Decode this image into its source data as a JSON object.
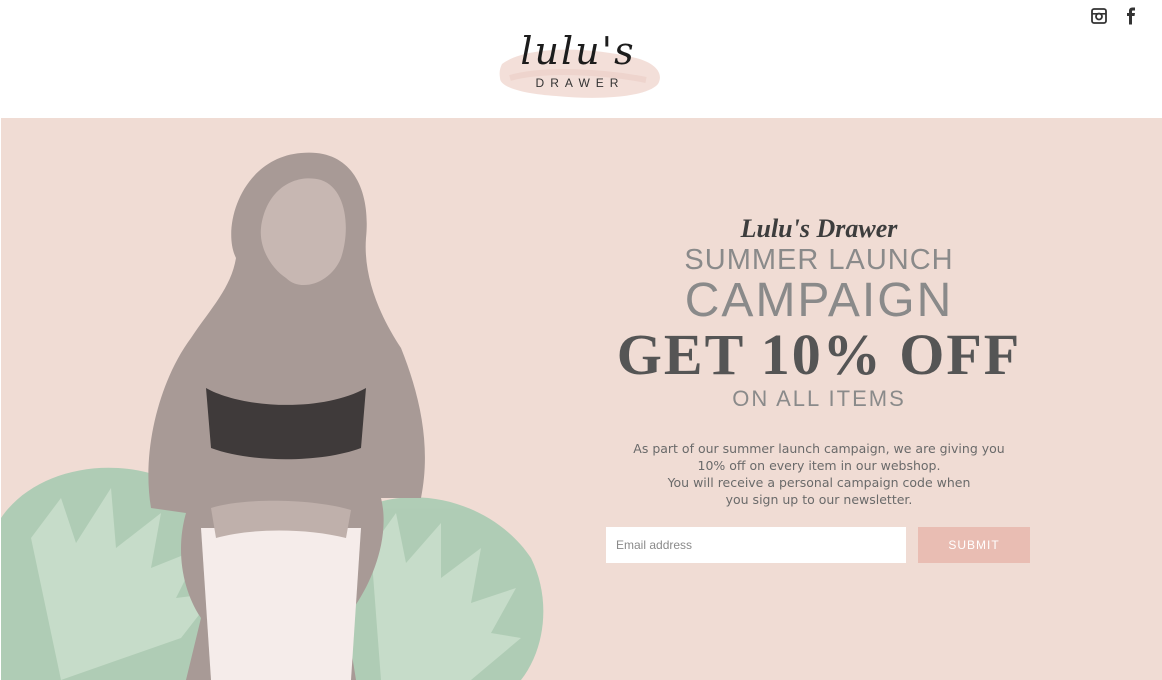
{
  "header": {
    "logo": {
      "script": "lulu's",
      "subtitle": "DRAWER"
    },
    "social": [
      {
        "name": "instagram",
        "icon": "instagram-icon"
      },
      {
        "name": "facebook",
        "icon": "facebook-icon"
      }
    ]
  },
  "hero": {
    "brand_line": "Lulu's Drawer",
    "line_summer": "SUMMER LAUNCH",
    "line_campaign": "CAMPAIGN",
    "line_offer": "GET 10% OFF",
    "line_all": "ON ALL ITEMS",
    "description": [
      "As part of our summer launch campaign, we are giving you",
      "10% off on every item in our webshop.",
      "You will receive a personal campaign code when",
      "you sign up to our newsletter."
    ],
    "form": {
      "email_placeholder": "Email address",
      "email_value": "",
      "submit_label": "SUBMIT"
    }
  },
  "colors": {
    "hero_bg": "#f0dcd4",
    "submit_bg": "#e9bdb3",
    "leaf": "#a9cbb2",
    "text_dark": "#555555"
  }
}
